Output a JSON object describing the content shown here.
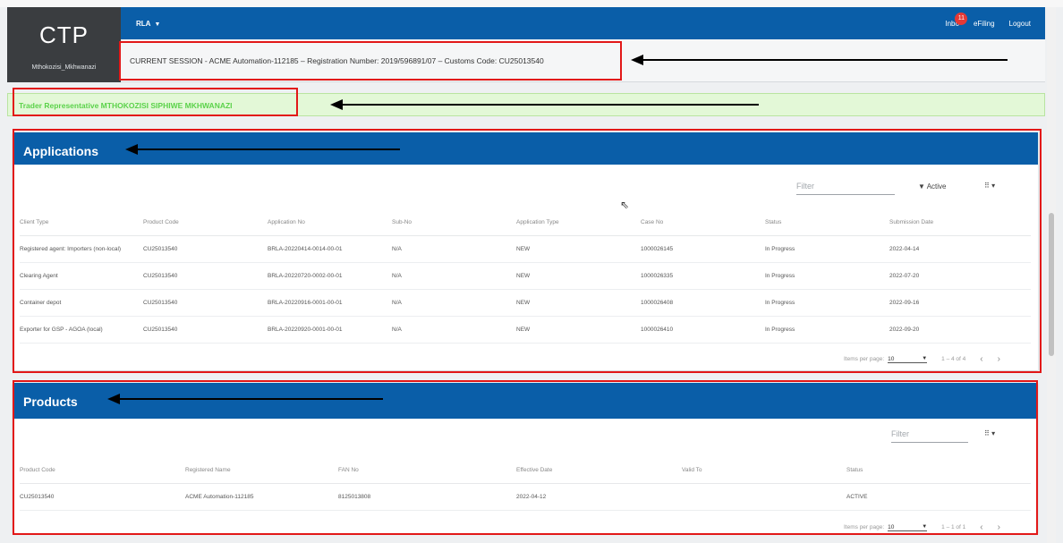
{
  "brand": {
    "logo": "CTP",
    "username": "Mthokozisi_Mkhwanazi"
  },
  "navbar": {
    "menu_label": "RLA",
    "inbox_label": "Inbo",
    "inbox_badge": "11",
    "efiling_label": "eFiling",
    "logout_label": "Logout"
  },
  "session": {
    "text": "CURRENT SESSION - ACME Automation-112185 – Registration Number: 2019/596891/07 – Customs Code: CU25013540"
  },
  "representative": {
    "label": "Trader Representative",
    "name": "MTHOKOZISI SIPHIWE MKHWANAZI"
  },
  "applications": {
    "title": "Applications",
    "filter_placeholder": "Filter",
    "active_label": "Active",
    "columns": [
      "Client Type",
      "Product Code",
      "Application No",
      "Sub-No",
      "Application Type",
      "Case No",
      "Status",
      "Submission Date"
    ],
    "rows": [
      [
        "Registered agent: Importers (non-local)",
        "CU25013540",
        "BRLA-20220414-0014-00-01",
        "N/A",
        "NEW",
        "1000026145",
        "In Progress",
        "2022-04-14"
      ],
      [
        "Clearing Agent",
        "CU25013540",
        "BRLA-20220720-0002-00-01",
        "N/A",
        "NEW",
        "1000026335",
        "In Progress",
        "2022-07-20"
      ],
      [
        "Container depot",
        "CU25013540",
        "BRLA-20220916-0001-00-01",
        "N/A",
        "NEW",
        "1000026408",
        "In Progress",
        "2022-09-16"
      ],
      [
        "Exporter for GSP - AGOA (local)",
        "CU25013540",
        "BRLA-20220920-0001-00-01",
        "N/A",
        "NEW",
        "1000026410",
        "In Progress",
        "2022-09-20"
      ]
    ],
    "items_per_page_label": "Items per page:",
    "items_per_page": "10",
    "range": "1 – 4 of 4"
  },
  "products": {
    "title": "Products",
    "filter_placeholder": "Filter",
    "columns": [
      "Product Code",
      "Registered Name",
      "FAN No",
      "Effective Date",
      "Valid To",
      "Status"
    ],
    "rows": [
      [
        "CU25013540",
        "ACME Automation-112185",
        "8125013808",
        "2022-04-12",
        "",
        "ACTIVE"
      ]
    ],
    "items_per_page_label": "Items per page:",
    "items_per_page": "10",
    "range": "1 – 1 of 1"
  },
  "colors": {
    "nav_blue": "#0a5ea8",
    "logo_dark": "#3a3d40",
    "rep_green_text": "#5bd24a",
    "rep_green_bg": "#e3f8d7",
    "highlight_red": "#e21818"
  }
}
